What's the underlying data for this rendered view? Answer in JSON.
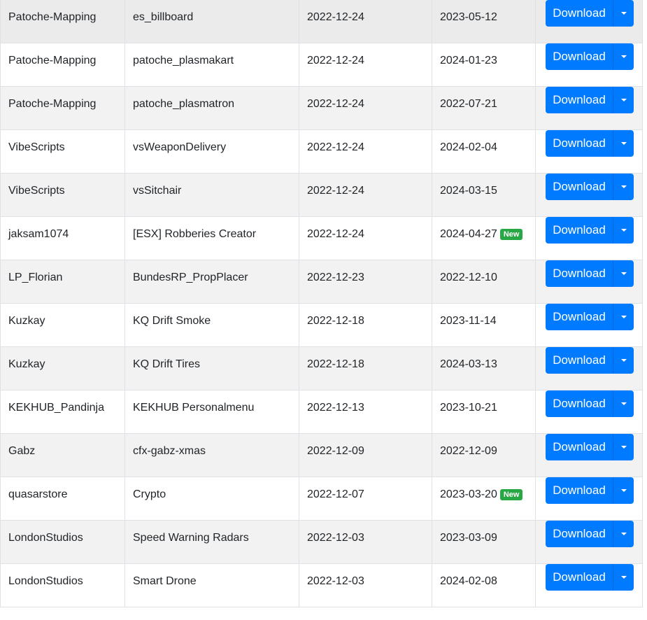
{
  "button_label": "Download",
  "rows": [
    {
      "author": "Patoche-Mapping",
      "resource": "es_billboard",
      "created": "2022-12-24",
      "updated": "2023-05-12",
      "badge": ""
    },
    {
      "author": "Patoche-Mapping",
      "resource": "patoche_plasmakart",
      "created": "2022-12-24",
      "updated": "2024-01-23",
      "badge": ""
    },
    {
      "author": "Patoche-Mapping",
      "resource": "patoche_plasmatron",
      "created": "2022-12-24",
      "updated": "2022-07-21",
      "badge": ""
    },
    {
      "author": "VibeScripts",
      "resource": "vsWeaponDelivery",
      "created": "2022-12-24",
      "updated": "2024-02-04",
      "badge": ""
    },
    {
      "author": "VibeScripts",
      "resource": "vsSitchair",
      "created": "2022-12-24",
      "updated": "2024-03-15",
      "badge": ""
    },
    {
      "author": "jaksam1074",
      "resource": "[ESX] Robberies Creator",
      "created": "2022-12-24",
      "updated": "2024-04-27",
      "badge": "New"
    },
    {
      "author": "LP_Florian",
      "resource": "BundesRP_PropPlacer",
      "created": "2022-12-23",
      "updated": "2022-12-10",
      "badge": ""
    },
    {
      "author": "Kuzkay",
      "resource": "KQ Drift Smoke",
      "created": "2022-12-18",
      "updated": "2023-11-14",
      "badge": ""
    },
    {
      "author": "Kuzkay",
      "resource": "KQ Drift Tires",
      "created": "2022-12-18",
      "updated": "2024-03-13",
      "badge": ""
    },
    {
      "author": "KEKHUB_Pandinja",
      "resource": "KEKHUB Personalmenu",
      "created": "2022-12-13",
      "updated": "2023-10-21",
      "badge": ""
    },
    {
      "author": "Gabz",
      "resource": "cfx-gabz-xmas",
      "created": "2022-12-09",
      "updated": "2022-12-09",
      "badge": ""
    },
    {
      "author": "quasarstore",
      "resource": "Crypto",
      "created": "2022-12-07",
      "updated": "2023-03-20",
      "badge": "New"
    },
    {
      "author": "LondonStudios",
      "resource": "Speed Warning Radars",
      "created": "2022-12-03",
      "updated": "2023-03-09",
      "badge": ""
    },
    {
      "author": "LondonStudios",
      "resource": "Smart Drone",
      "created": "2022-12-03",
      "updated": "2024-02-08",
      "badge": ""
    }
  ],
  "colors": {
    "primary": "#007bff",
    "badge_new": "#28a745",
    "row_stripe": "#f2f2f2",
    "border": "#dee2e6"
  },
  "icons": {
    "toggle": "caret-down-icon"
  }
}
